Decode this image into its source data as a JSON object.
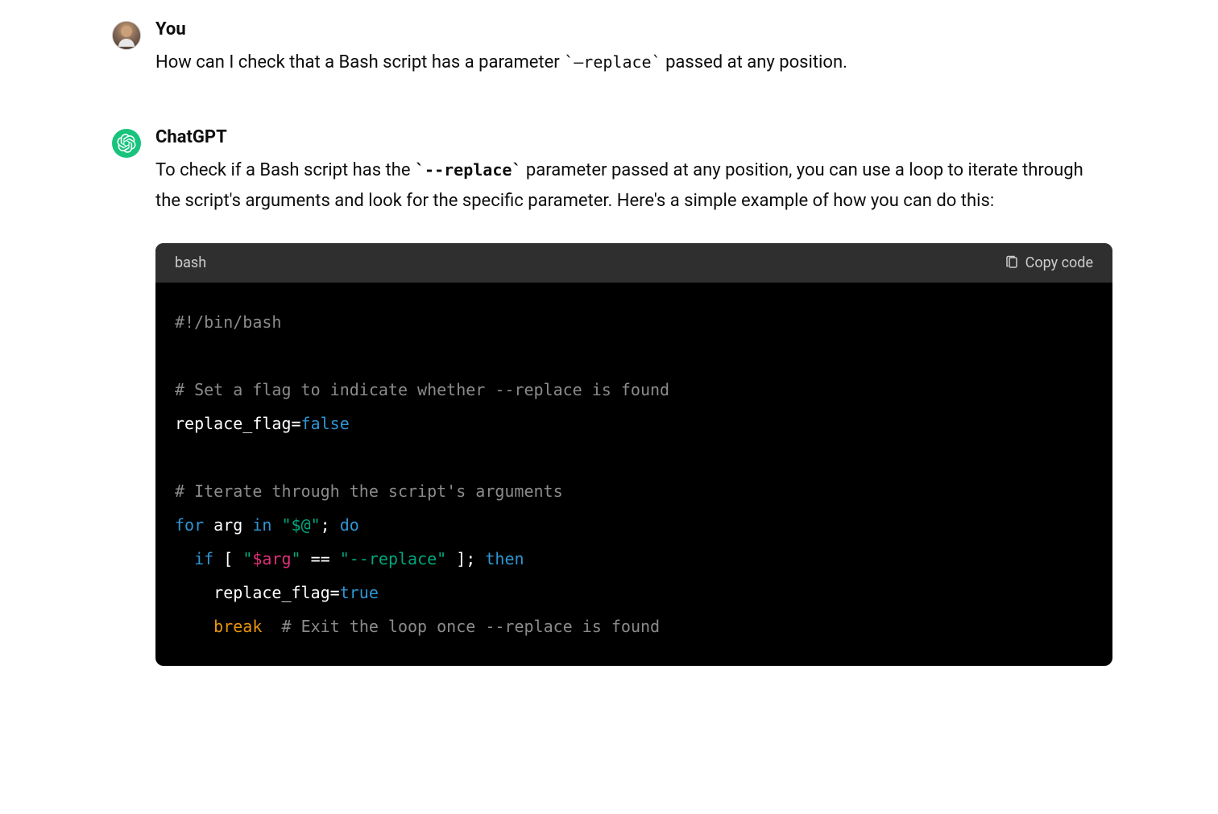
{
  "messages": {
    "user": {
      "author": "You",
      "text_before": "How can I check that a Bash script has a parameter ",
      "inline_code": "`—replace`",
      "text_after": " passed at any position."
    },
    "assistant": {
      "author": "ChatGPT",
      "text_before": "To check if a Bash script has the ",
      "inline_code": "`--replace`",
      "text_after": " parameter passed at any position, you can use a loop to iterate through the script's arguments and look for the specific parameter. Here's a simple example of how you can do this:"
    }
  },
  "code_block": {
    "language": "bash",
    "copy_label": "Copy code",
    "lines": {
      "l1_comment": "#!/bin/bash",
      "l2_blank": "",
      "l3_comment": "# Set a flag to indicate whether --replace is found",
      "l4_a": "replace_flag=",
      "l4_b": "false",
      "l5_blank": "",
      "l6_comment": "# Iterate through the script's arguments",
      "l7_for": "for",
      "l7_arg": " arg ",
      "l7_in": "in",
      "l7_sp": " ",
      "l7_str": "\"$@\"",
      "l7_semi": "; ",
      "l7_do": "do",
      "l8_indent": "  ",
      "l8_if": "if",
      "l8_a": " [ ",
      "l8_str1": "\"",
      "l8_var": "$arg",
      "l8_str1b": "\"",
      "l8_eq": " == ",
      "l8_str2": "\"--replace\"",
      "l8_b": " ]; ",
      "l8_then": "then",
      "l9_indent": "    ",
      "l9_a": "replace_flag=",
      "l9_b": "true",
      "l10_indent": "    ",
      "l10_break": "break",
      "l10_sp": "  ",
      "l10_comment": "# Exit the loop once --replace is found"
    }
  }
}
